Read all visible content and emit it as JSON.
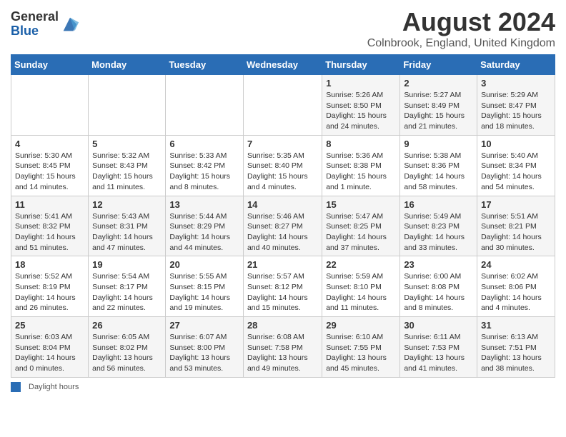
{
  "header": {
    "logo_general": "General",
    "logo_blue": "Blue",
    "title": "August 2024",
    "location": "Colnbrook, England, United Kingdom"
  },
  "days_of_week": [
    "Sunday",
    "Monday",
    "Tuesday",
    "Wednesday",
    "Thursday",
    "Friday",
    "Saturday"
  ],
  "weeks": [
    [
      {
        "day": "",
        "info": ""
      },
      {
        "day": "",
        "info": ""
      },
      {
        "day": "",
        "info": ""
      },
      {
        "day": "",
        "info": ""
      },
      {
        "day": "1",
        "info": "Sunrise: 5:26 AM\nSunset: 8:50 PM\nDaylight: 15 hours\nand 24 minutes."
      },
      {
        "day": "2",
        "info": "Sunrise: 5:27 AM\nSunset: 8:49 PM\nDaylight: 15 hours\nand 21 minutes."
      },
      {
        "day": "3",
        "info": "Sunrise: 5:29 AM\nSunset: 8:47 PM\nDaylight: 15 hours\nand 18 minutes."
      }
    ],
    [
      {
        "day": "4",
        "info": "Sunrise: 5:30 AM\nSunset: 8:45 PM\nDaylight: 15 hours\nand 14 minutes."
      },
      {
        "day": "5",
        "info": "Sunrise: 5:32 AM\nSunset: 8:43 PM\nDaylight: 15 hours\nand 11 minutes."
      },
      {
        "day": "6",
        "info": "Sunrise: 5:33 AM\nSunset: 8:42 PM\nDaylight: 15 hours\nand 8 minutes."
      },
      {
        "day": "7",
        "info": "Sunrise: 5:35 AM\nSunset: 8:40 PM\nDaylight: 15 hours\nand 4 minutes."
      },
      {
        "day": "8",
        "info": "Sunrise: 5:36 AM\nSunset: 8:38 PM\nDaylight: 15 hours\nand 1 minute."
      },
      {
        "day": "9",
        "info": "Sunrise: 5:38 AM\nSunset: 8:36 PM\nDaylight: 14 hours\nand 58 minutes."
      },
      {
        "day": "10",
        "info": "Sunrise: 5:40 AM\nSunset: 8:34 PM\nDaylight: 14 hours\nand 54 minutes."
      }
    ],
    [
      {
        "day": "11",
        "info": "Sunrise: 5:41 AM\nSunset: 8:32 PM\nDaylight: 14 hours\nand 51 minutes."
      },
      {
        "day": "12",
        "info": "Sunrise: 5:43 AM\nSunset: 8:31 PM\nDaylight: 14 hours\nand 47 minutes."
      },
      {
        "day": "13",
        "info": "Sunrise: 5:44 AM\nSunset: 8:29 PM\nDaylight: 14 hours\nand 44 minutes."
      },
      {
        "day": "14",
        "info": "Sunrise: 5:46 AM\nSunset: 8:27 PM\nDaylight: 14 hours\nand 40 minutes."
      },
      {
        "day": "15",
        "info": "Sunrise: 5:47 AM\nSunset: 8:25 PM\nDaylight: 14 hours\nand 37 minutes."
      },
      {
        "day": "16",
        "info": "Sunrise: 5:49 AM\nSunset: 8:23 PM\nDaylight: 14 hours\nand 33 minutes."
      },
      {
        "day": "17",
        "info": "Sunrise: 5:51 AM\nSunset: 8:21 PM\nDaylight: 14 hours\nand 30 minutes."
      }
    ],
    [
      {
        "day": "18",
        "info": "Sunrise: 5:52 AM\nSunset: 8:19 PM\nDaylight: 14 hours\nand 26 minutes."
      },
      {
        "day": "19",
        "info": "Sunrise: 5:54 AM\nSunset: 8:17 PM\nDaylight: 14 hours\nand 22 minutes."
      },
      {
        "day": "20",
        "info": "Sunrise: 5:55 AM\nSunset: 8:15 PM\nDaylight: 14 hours\nand 19 minutes."
      },
      {
        "day": "21",
        "info": "Sunrise: 5:57 AM\nSunset: 8:12 PM\nDaylight: 14 hours\nand 15 minutes."
      },
      {
        "day": "22",
        "info": "Sunrise: 5:59 AM\nSunset: 8:10 PM\nDaylight: 14 hours\nand 11 minutes."
      },
      {
        "day": "23",
        "info": "Sunrise: 6:00 AM\nSunset: 8:08 PM\nDaylight: 14 hours\nand 8 minutes."
      },
      {
        "day": "24",
        "info": "Sunrise: 6:02 AM\nSunset: 8:06 PM\nDaylight: 14 hours\nand 4 minutes."
      }
    ],
    [
      {
        "day": "25",
        "info": "Sunrise: 6:03 AM\nSunset: 8:04 PM\nDaylight: 14 hours\nand 0 minutes."
      },
      {
        "day": "26",
        "info": "Sunrise: 6:05 AM\nSunset: 8:02 PM\nDaylight: 13 hours\nand 56 minutes."
      },
      {
        "day": "27",
        "info": "Sunrise: 6:07 AM\nSunset: 8:00 PM\nDaylight: 13 hours\nand 53 minutes."
      },
      {
        "day": "28",
        "info": "Sunrise: 6:08 AM\nSunset: 7:58 PM\nDaylight: 13 hours\nand 49 minutes."
      },
      {
        "day": "29",
        "info": "Sunrise: 6:10 AM\nSunset: 7:55 PM\nDaylight: 13 hours\nand 45 minutes."
      },
      {
        "day": "30",
        "info": "Sunrise: 6:11 AM\nSunset: 7:53 PM\nDaylight: 13 hours\nand 41 minutes."
      },
      {
        "day": "31",
        "info": "Sunrise: 6:13 AM\nSunset: 7:51 PM\nDaylight: 13 hours\nand 38 minutes."
      }
    ]
  ],
  "footer": {
    "legend_label": "Daylight hours"
  }
}
